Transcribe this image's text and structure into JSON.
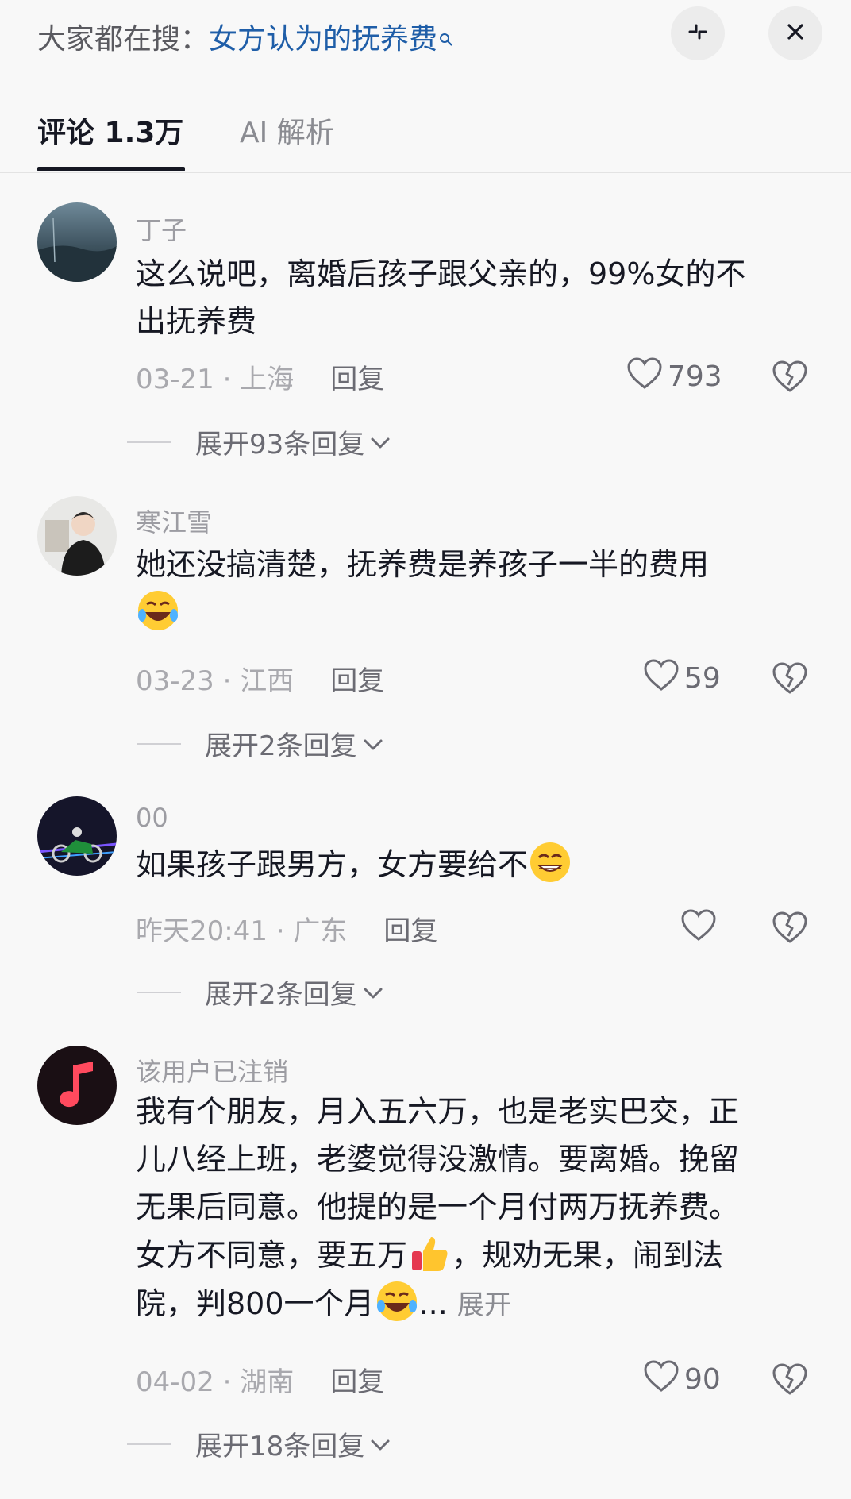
{
  "search": {
    "prefix": "大家都在搜：",
    "query": "女方认为的抚养费",
    "icon": "search-icon"
  },
  "header_buttons": {
    "collapse_icon": "collapse-icon",
    "close_icon": "close-icon"
  },
  "tabs": [
    {
      "label": "评论 1.3万",
      "active": true
    },
    {
      "label": "AI 解析",
      "active": false
    }
  ],
  "comments": [
    {
      "username": "丁子",
      "text_lines": [
        "这么说吧，离婚后孩子跟父亲的，99%女的不",
        "出抚养费"
      ],
      "date": "03-21",
      "location": "上海",
      "reply_label": "回复",
      "likes": "793",
      "expand_label": "展开93条回复"
    },
    {
      "username": "寒江雪",
      "text_lines": [
        "她还没搞清楚，抚养费是养孩子一半的费用"
      ],
      "date": "03-23",
      "location": "江西",
      "reply_label": "回复",
      "likes": "59",
      "expand_label": "展开2条回复"
    },
    {
      "username": "00",
      "text_lines": [
        "如果孩子跟男方，女方要给不"
      ],
      "date": "昨天20:41",
      "location": "广东",
      "reply_label": "回复",
      "likes": "",
      "expand_label": "展开2条回复"
    },
    {
      "username": "该用户已注销",
      "text_lines": [
        "我有个朋友，月入五六万，也是老实巴交，正",
        "儿八经上班，老婆觉得没激情。要离婚。挽留",
        "无果后同意。他提的是一个月付两万抚养费。",
        "女方不同意，要五万",
        "，规劝无果，闹到法",
        "院，判800一个月",
        "...",
        "展开"
      ],
      "date": "04-02",
      "location": "湖南",
      "reply_label": "回复",
      "likes": "90",
      "expand_label": "展开18条回复"
    }
  ],
  "separator": "·",
  "colors": {
    "link": "#1f5ea8",
    "text": "#161823",
    "muted": "#a9a9ae",
    "background": "#f8f8f8"
  }
}
